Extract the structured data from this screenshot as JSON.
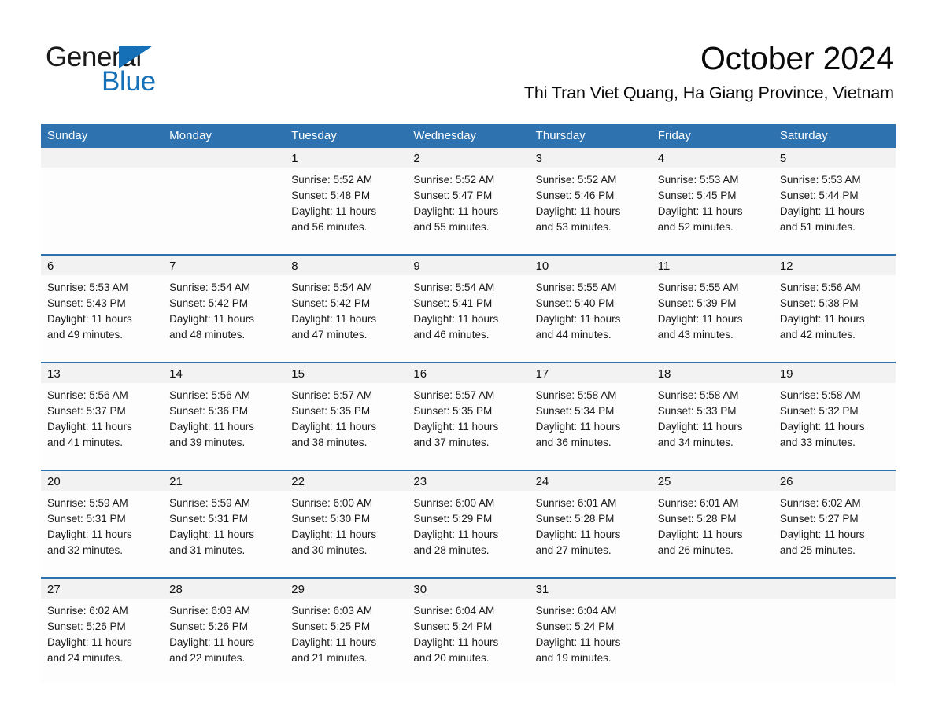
{
  "brand": {
    "name_dark": "General",
    "name_blue": "Blue",
    "triangle_color": "#1570b8"
  },
  "header": {
    "month_title": "October 2024",
    "location": "Thi Tran Viet Quang, Ha Giang Province, Vietnam"
  },
  "colors": {
    "header_blue": "#2e72b0",
    "row_divider_blue": "#2e72b0",
    "daynum_band": "#f2f2f2",
    "cell_background": "#fdfdfd",
    "text": "#1a1a1a",
    "header_text": "#ffffff"
  },
  "calendar": {
    "weekdays": [
      "Sunday",
      "Monday",
      "Tuesday",
      "Wednesday",
      "Thursday",
      "Friday",
      "Saturday"
    ],
    "weeks": [
      [
        {
          "day": "",
          "lines": []
        },
        {
          "day": "",
          "lines": []
        },
        {
          "day": "1",
          "lines": [
            "Sunrise: 5:52 AM",
            "Sunset: 5:48 PM",
            "Daylight: 11 hours",
            "and 56 minutes."
          ]
        },
        {
          "day": "2",
          "lines": [
            "Sunrise: 5:52 AM",
            "Sunset: 5:47 PM",
            "Daylight: 11 hours",
            "and 55 minutes."
          ]
        },
        {
          "day": "3",
          "lines": [
            "Sunrise: 5:52 AM",
            "Sunset: 5:46 PM",
            "Daylight: 11 hours",
            "and 53 minutes."
          ]
        },
        {
          "day": "4",
          "lines": [
            "Sunrise: 5:53 AM",
            "Sunset: 5:45 PM",
            "Daylight: 11 hours",
            "and 52 minutes."
          ]
        },
        {
          "day": "5",
          "lines": [
            "Sunrise: 5:53 AM",
            "Sunset: 5:44 PM",
            "Daylight: 11 hours",
            "and 51 minutes."
          ]
        }
      ],
      [
        {
          "day": "6",
          "lines": [
            "Sunrise: 5:53 AM",
            "Sunset: 5:43 PM",
            "Daylight: 11 hours",
            "and 49 minutes."
          ]
        },
        {
          "day": "7",
          "lines": [
            "Sunrise: 5:54 AM",
            "Sunset: 5:42 PM",
            "Daylight: 11 hours",
            "and 48 minutes."
          ]
        },
        {
          "day": "8",
          "lines": [
            "Sunrise: 5:54 AM",
            "Sunset: 5:42 PM",
            "Daylight: 11 hours",
            "and 47 minutes."
          ]
        },
        {
          "day": "9",
          "lines": [
            "Sunrise: 5:54 AM",
            "Sunset: 5:41 PM",
            "Daylight: 11 hours",
            "and 46 minutes."
          ]
        },
        {
          "day": "10",
          "lines": [
            "Sunrise: 5:55 AM",
            "Sunset: 5:40 PM",
            "Daylight: 11 hours",
            "and 44 minutes."
          ]
        },
        {
          "day": "11",
          "lines": [
            "Sunrise: 5:55 AM",
            "Sunset: 5:39 PM",
            "Daylight: 11 hours",
            "and 43 minutes."
          ]
        },
        {
          "day": "12",
          "lines": [
            "Sunrise: 5:56 AM",
            "Sunset: 5:38 PM",
            "Daylight: 11 hours",
            "and 42 minutes."
          ]
        }
      ],
      [
        {
          "day": "13",
          "lines": [
            "Sunrise: 5:56 AM",
            "Sunset: 5:37 PM",
            "Daylight: 11 hours",
            "and 41 minutes."
          ]
        },
        {
          "day": "14",
          "lines": [
            "Sunrise: 5:56 AM",
            "Sunset: 5:36 PM",
            "Daylight: 11 hours",
            "and 39 minutes."
          ]
        },
        {
          "day": "15",
          "lines": [
            "Sunrise: 5:57 AM",
            "Sunset: 5:35 PM",
            "Daylight: 11 hours",
            "and 38 minutes."
          ]
        },
        {
          "day": "16",
          "lines": [
            "Sunrise: 5:57 AM",
            "Sunset: 5:35 PM",
            "Daylight: 11 hours",
            "and 37 minutes."
          ]
        },
        {
          "day": "17",
          "lines": [
            "Sunrise: 5:58 AM",
            "Sunset: 5:34 PM",
            "Daylight: 11 hours",
            "and 36 minutes."
          ]
        },
        {
          "day": "18",
          "lines": [
            "Sunrise: 5:58 AM",
            "Sunset: 5:33 PM",
            "Daylight: 11 hours",
            "and 34 minutes."
          ]
        },
        {
          "day": "19",
          "lines": [
            "Sunrise: 5:58 AM",
            "Sunset: 5:32 PM",
            "Daylight: 11 hours",
            "and 33 minutes."
          ]
        }
      ],
      [
        {
          "day": "20",
          "lines": [
            "Sunrise: 5:59 AM",
            "Sunset: 5:31 PM",
            "Daylight: 11 hours",
            "and 32 minutes."
          ]
        },
        {
          "day": "21",
          "lines": [
            "Sunrise: 5:59 AM",
            "Sunset: 5:31 PM",
            "Daylight: 11 hours",
            "and 31 minutes."
          ]
        },
        {
          "day": "22",
          "lines": [
            "Sunrise: 6:00 AM",
            "Sunset: 5:30 PM",
            "Daylight: 11 hours",
            "and 30 minutes."
          ]
        },
        {
          "day": "23",
          "lines": [
            "Sunrise: 6:00 AM",
            "Sunset: 5:29 PM",
            "Daylight: 11 hours",
            "and 28 minutes."
          ]
        },
        {
          "day": "24",
          "lines": [
            "Sunrise: 6:01 AM",
            "Sunset: 5:28 PM",
            "Daylight: 11 hours",
            "and 27 minutes."
          ]
        },
        {
          "day": "25",
          "lines": [
            "Sunrise: 6:01 AM",
            "Sunset: 5:28 PM",
            "Daylight: 11 hours",
            "and 26 minutes."
          ]
        },
        {
          "day": "26",
          "lines": [
            "Sunrise: 6:02 AM",
            "Sunset: 5:27 PM",
            "Daylight: 11 hours",
            "and 25 minutes."
          ]
        }
      ],
      [
        {
          "day": "27",
          "lines": [
            "Sunrise: 6:02 AM",
            "Sunset: 5:26 PM",
            "Daylight: 11 hours",
            "and 24 minutes."
          ]
        },
        {
          "day": "28",
          "lines": [
            "Sunrise: 6:03 AM",
            "Sunset: 5:26 PM",
            "Daylight: 11 hours",
            "and 22 minutes."
          ]
        },
        {
          "day": "29",
          "lines": [
            "Sunrise: 6:03 AM",
            "Sunset: 5:25 PM",
            "Daylight: 11 hours",
            "and 21 minutes."
          ]
        },
        {
          "day": "30",
          "lines": [
            "Sunrise: 6:04 AM",
            "Sunset: 5:24 PM",
            "Daylight: 11 hours",
            "and 20 minutes."
          ]
        },
        {
          "day": "31",
          "lines": [
            "Sunrise: 6:04 AM",
            "Sunset: 5:24 PM",
            "Daylight: 11 hours",
            "and 19 minutes."
          ]
        },
        {
          "day": "",
          "lines": []
        },
        {
          "day": "",
          "lines": []
        }
      ]
    ]
  }
}
